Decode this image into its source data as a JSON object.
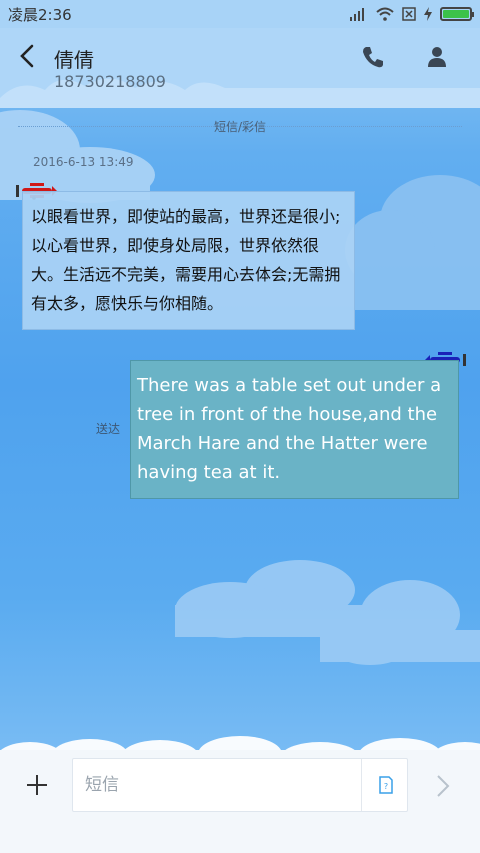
{
  "status_bar": {
    "time": "凌晨2:36",
    "icons": [
      "signal-icon",
      "wifi-icon",
      "no-sim-icon",
      "charging-icon",
      "battery-icon"
    ],
    "battery_level": 1.0,
    "battery_color": "#3cc24a"
  },
  "header": {
    "contact_name": "倩倩",
    "contact_number": "18730218809",
    "icons": [
      "back-icon",
      "phone-icon",
      "person-icon"
    ]
  },
  "thread": {
    "message_type": "短信/彩信",
    "timestamp": "2016-6-13 13:49",
    "incoming": {
      "text": "以眼看世界，即使站的最高，世界还是很小;以心看世界，即使身处局限，世界依然很大。生活远不完美，需要用心去体会;无需拥有太多，愿快乐与你相随。"
    },
    "outgoing": {
      "text": "There was a table set out under a tree in front of the house,and the March Hare and the Hatter were having tea at it.",
      "status": "送达"
    }
  },
  "composer": {
    "placeholder": "短信",
    "value": "",
    "icons": [
      "plus-icon",
      "sim-card-icon",
      "send-arrow-icon"
    ]
  },
  "colors": {
    "incoming_bubble": "#aad2f5",
    "outgoing_bubble": "#6ab3c6",
    "background": "#4fa2ee"
  }
}
